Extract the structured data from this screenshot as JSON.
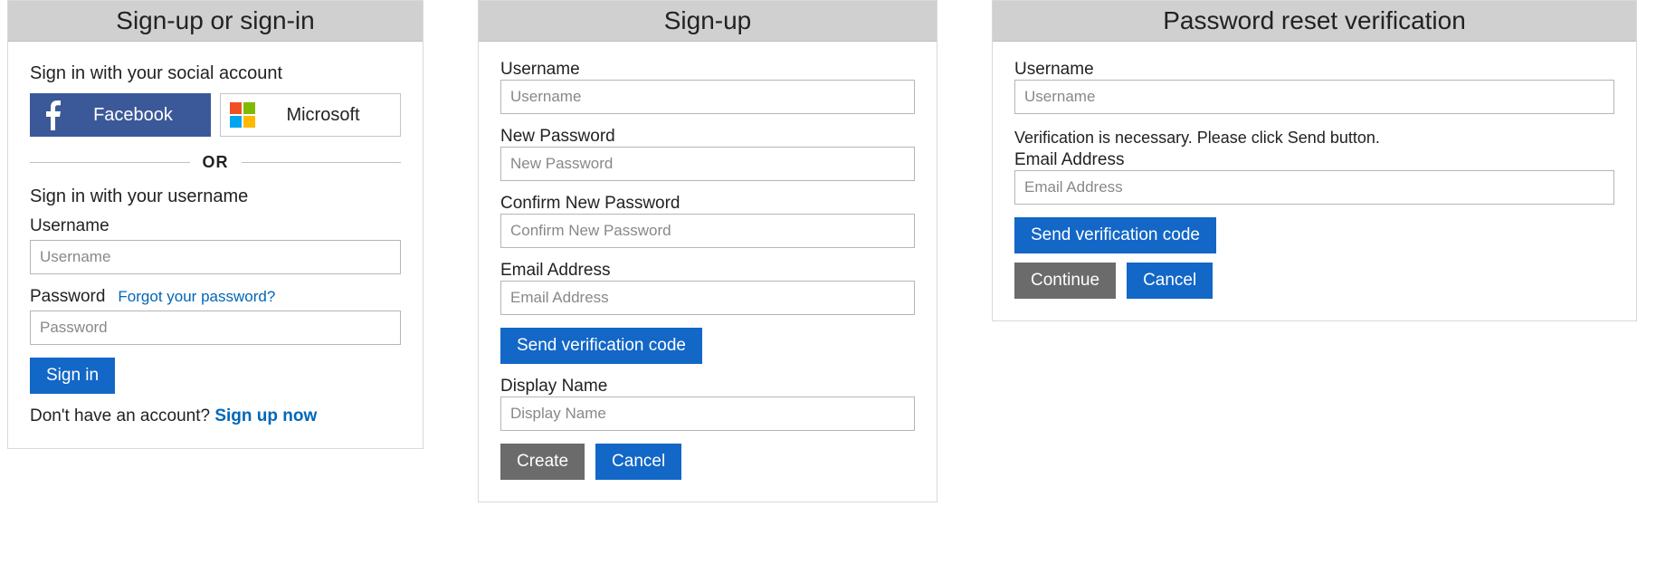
{
  "colors": {
    "primary": "#1267c7",
    "secondary": "#6b6b6b",
    "facebook": "#3b5998",
    "link": "#0067b8",
    "panel_header_bg": "#d0d0d0"
  },
  "panel1": {
    "title": "Sign-up or sign-in",
    "social_heading": "Sign in with your social account",
    "facebook_label": "Facebook",
    "microsoft_label": "Microsoft",
    "or_text": "OR",
    "local_heading": "Sign in with your username",
    "username_label": "Username",
    "username_placeholder": "Username",
    "password_label": "Password",
    "forgot_link": "Forgot your password?",
    "password_placeholder": "Password",
    "signin_button": "Sign in",
    "no_account_text": "Don't have an account? ",
    "signup_link": "Sign up now"
  },
  "panel2": {
    "title": "Sign-up",
    "username_label": "Username",
    "username_placeholder": "Username",
    "newpw_label": "New Password",
    "newpw_placeholder": "New Password",
    "confirmpw_label": "Confirm New Password",
    "confirmpw_placeholder": "Confirm New Password",
    "email_label": "Email Address",
    "email_placeholder": "Email Address",
    "send_code_button": "Send verification code",
    "display_label": "Display Name",
    "display_placeholder": "Display Name",
    "create_button": "Create",
    "cancel_button": "Cancel"
  },
  "panel3": {
    "title": "Password reset verification",
    "username_label": "Username",
    "username_placeholder": "Username",
    "info_text": "Verification is necessary. Please click Send button.",
    "email_label": "Email Address",
    "email_placeholder": "Email Address",
    "send_code_button": "Send verification code",
    "continue_button": "Continue",
    "cancel_button": "Cancel"
  }
}
